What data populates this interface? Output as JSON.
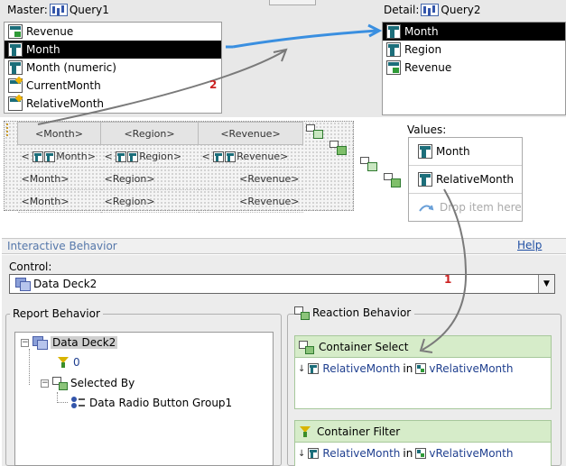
{
  "master": {
    "label": "Master:",
    "query_name": "Query1",
    "items": [
      {
        "label": "Revenue",
        "icon": "metric-icon",
        "selected": false
      },
      {
        "label": "Month",
        "icon": "attribute-icon",
        "selected": true
      },
      {
        "label": "Month (numeric)",
        "icon": "attribute-icon",
        "selected": false
      },
      {
        "label": "CurrentMonth",
        "icon": "derived-attribute-icon",
        "selected": false
      },
      {
        "label": "RelativeMonth",
        "icon": "derived-attribute-icon",
        "selected": false
      }
    ]
  },
  "detail": {
    "label": "Detail:",
    "query_name": "Query2",
    "items": [
      {
        "label": "Month",
        "icon": "attribute-icon",
        "selected": true
      },
      {
        "label": "Region",
        "icon": "attribute-icon",
        "selected": false
      },
      {
        "label": "Revenue",
        "icon": "metric-icon",
        "selected": false
      }
    ]
  },
  "grid": {
    "headers": [
      "<Month>",
      "<Region>",
      "<Revenue>"
    ],
    "field_row": [
      "Month",
      "Region",
      "Revenue"
    ],
    "lt": "<",
    "gt": ">",
    "rows": [
      [
        "<Month>",
        "<Region>",
        "<Revenue>"
      ],
      [
        "<Month>",
        "<Region>",
        "<Revenue>"
      ]
    ]
  },
  "values_panel": {
    "label": "Values:",
    "items": [
      "Month",
      "RelativeMonth"
    ],
    "drop_hint": "Drop item here"
  },
  "annotations": {
    "one": "1",
    "two": "2"
  },
  "interactive_behavior": {
    "title": "Interactive Behavior",
    "help": "Help",
    "control_label": "Control:",
    "control_value": "Data Deck2"
  },
  "report_behavior": {
    "legend": "Report Behavior",
    "root": "Data Deck2",
    "filter_value": "0",
    "selected_by": "Selected By",
    "selector": "Data Radio Button Group1"
  },
  "reaction_behavior": {
    "legend": "Reaction Behavior",
    "in_word": "in",
    "cards": [
      {
        "title": "Container Select",
        "field": "RelativeMonth",
        "variable": "vRelativeMonth"
      },
      {
        "title": "Container Filter",
        "field": "RelativeMonth",
        "variable": "vRelativeMonth"
      }
    ]
  },
  "colors": {
    "arrow_blue": "#3a8fe0",
    "arrow_gray": "#7a7a7a",
    "annotation_red": "#cc2222",
    "reaction_green": "#d6ecc9"
  }
}
